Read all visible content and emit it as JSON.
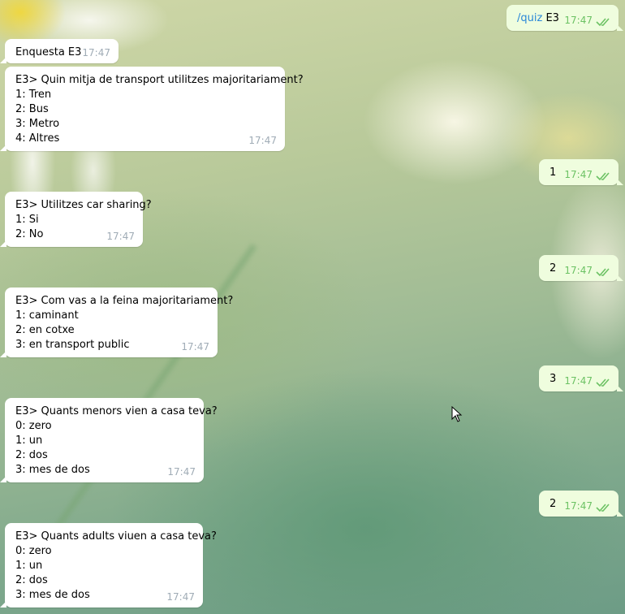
{
  "incoming": [
    {
      "lines": [
        "Enquesta E3"
      ],
      "time": "17:47"
    },
    {
      "lines": [
        "E3> Quin mitja de transport utilitzes majoritariament?",
        "1: Tren",
        "2: Bus",
        "3: Metro",
        "4: Altres"
      ],
      "time": "17:47"
    },
    {
      "lines": [
        "E3> Utilitzes car sharing?",
        "1: Si",
        "2: No"
      ],
      "time": "17:47"
    },
    {
      "lines": [
        "E3> Com vas a la feina majoritariament?",
        "1: caminant",
        "2: en cotxe",
        "3: en transport public"
      ],
      "time": "17:47"
    },
    {
      "lines": [
        "E3> Quants menors vien a casa teva?",
        "0: zero",
        "1: un",
        "2: dos",
        "3: mes de dos"
      ],
      "time": "17:47"
    },
    {
      "lines": [
        "E3> Quants adults viuen a casa teva?",
        "0: zero",
        "1: un",
        "2: dos",
        "3: mes de dos"
      ],
      "time": "17:47"
    }
  ],
  "outgoing": [
    {
      "command": "/quiz",
      "text": "E3",
      "time": "17:47",
      "status": "read"
    },
    {
      "text": "1",
      "time": "17:47",
      "status": "read"
    },
    {
      "text": "2",
      "time": "17:47",
      "status": "read"
    },
    {
      "text": "3",
      "time": "17:47",
      "status": "read"
    },
    {
      "text": "2",
      "time": "17:47",
      "status": "read"
    }
  ],
  "colors": {
    "incoming_bubble": "#ffffff",
    "outgoing_bubble": "#effdde",
    "read_check": "#6cc264",
    "command_link": "#2a88d8"
  }
}
